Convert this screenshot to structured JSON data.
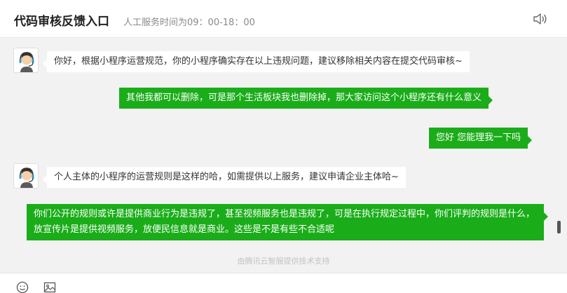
{
  "header": {
    "title": "代码审核反馈入口",
    "service_hours": "人工服务时间为09：00-18：00",
    "speaker_icon": "speaker-icon"
  },
  "messages": [
    {
      "side": "left",
      "text": "你好，根据小程序运营规范，你的小程序确实存在以上违规问题，建议移除相关内容在提交代码审核~"
    },
    {
      "side": "right",
      "text": "其他我都可以删除，可是那个生活板块我也删除掉，那大家访问这个小程序还有什么意义"
    },
    {
      "side": "right",
      "text": "您好  您能理我一下吗"
    },
    {
      "side": "left",
      "text": "个人主体的小程序的运营规则是这样的哈，如需提供以上服务，建议申请企业主体哈~"
    },
    {
      "side": "right",
      "text": "你们公开的规则或许是提供商业行为是违规了，甚至视频服务也是违规了，可是在执行规定过程中，你们评判的规则是什么，放宣传片是提供视频服务，放便民信息就是商业。这些是不是有些不合适呢"
    }
  ],
  "footer_note": "由腾讯云智服提供技术支持",
  "toolbar": {
    "emoji_icon": "emoji-icon",
    "image_icon": "image-icon"
  },
  "colors": {
    "accent_green": "#1aad19",
    "background": "#f2f2f2"
  }
}
